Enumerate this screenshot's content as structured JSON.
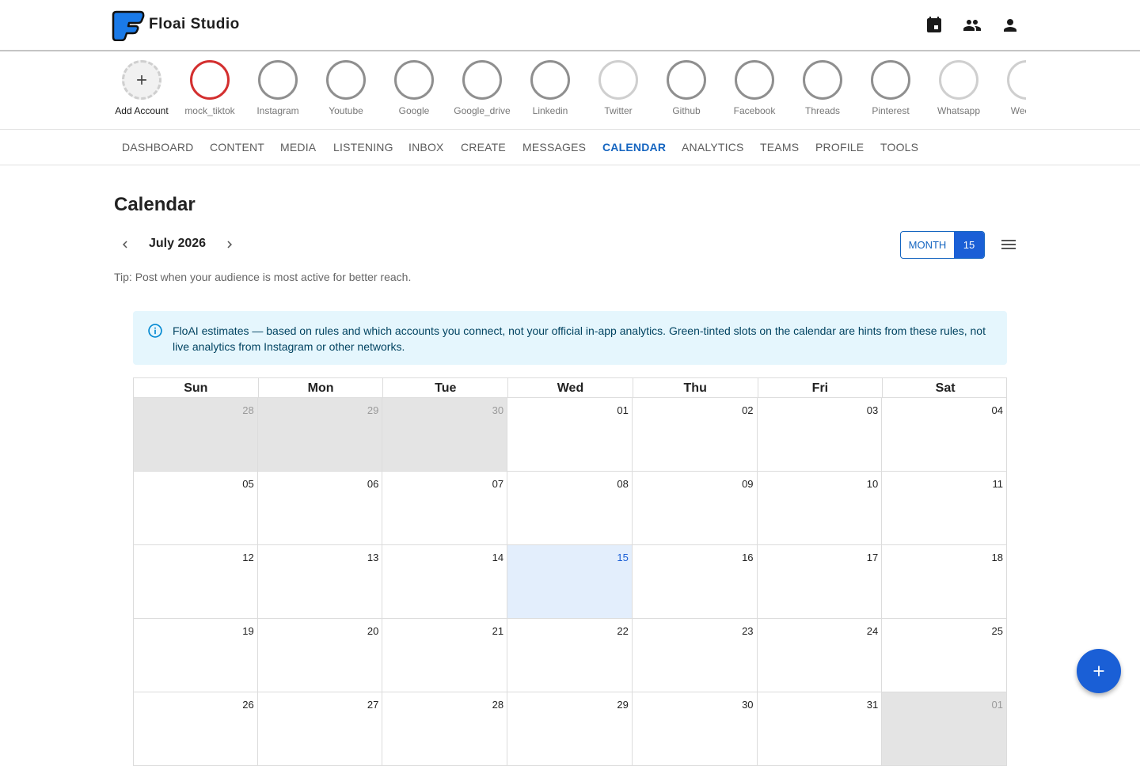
{
  "app": {
    "title": "Floai Studio"
  },
  "header_icons": [
    "calendar-icon",
    "people-icon",
    "person-icon"
  ],
  "accounts": [
    {
      "label": "Add Account",
      "kind": "add"
    },
    {
      "label": "mock_tiktok",
      "kind": "active"
    },
    {
      "label": "Instagram",
      "kind": "normal"
    },
    {
      "label": "Youtube",
      "kind": "normal"
    },
    {
      "label": "Google",
      "kind": "normal"
    },
    {
      "label": "Google_drive",
      "kind": "normal"
    },
    {
      "label": "Linkedin",
      "kind": "normal"
    },
    {
      "label": "Twitter",
      "kind": "light"
    },
    {
      "label": "Github",
      "kind": "normal"
    },
    {
      "label": "Facebook",
      "kind": "normal"
    },
    {
      "label": "Threads",
      "kind": "normal"
    },
    {
      "label": "Pinterest",
      "kind": "normal"
    },
    {
      "label": "Whatsapp",
      "kind": "light"
    },
    {
      "label": "Wechat",
      "kind": "light"
    }
  ],
  "nav": [
    {
      "label": "DASHBOARD"
    },
    {
      "label": "CONTENT"
    },
    {
      "label": "MEDIA"
    },
    {
      "label": "LISTENING"
    },
    {
      "label": "INBOX"
    },
    {
      "label": "CREATE"
    },
    {
      "label": "MESSAGES"
    },
    {
      "label": "CALENDAR",
      "active": true
    },
    {
      "label": "ANALYTICS"
    },
    {
      "label": "TEAMS"
    },
    {
      "label": "PROFILE"
    },
    {
      "label": "TOOLS"
    }
  ],
  "page": {
    "title": "Calendar",
    "month_label": "July 2026",
    "tip": "Tip: Post when your audience is most active for better reach.",
    "view_toggle": {
      "month": "MONTH",
      "day": "15"
    },
    "banner": "FloAI estimates — based on rules and which accounts you connect, not your official in-app analytics. Green-tinted slots on the calendar are hints from these rules, not live analytics from Instagram or other networks."
  },
  "calendar": {
    "weekdays": [
      "Sun",
      "Mon",
      "Tue",
      "Wed",
      "Thu",
      "Fri",
      "Sat"
    ],
    "weeks": [
      [
        {
          "d": "28",
          "o": true
        },
        {
          "d": "29",
          "o": true
        },
        {
          "d": "30",
          "o": true
        },
        {
          "d": "01"
        },
        {
          "d": "02"
        },
        {
          "d": "03"
        },
        {
          "d": "04"
        }
      ],
      [
        {
          "d": "05"
        },
        {
          "d": "06"
        },
        {
          "d": "07"
        },
        {
          "d": "08"
        },
        {
          "d": "09"
        },
        {
          "d": "10"
        },
        {
          "d": "11"
        }
      ],
      [
        {
          "d": "12"
        },
        {
          "d": "13"
        },
        {
          "d": "14"
        },
        {
          "d": "15",
          "t": true
        },
        {
          "d": "16"
        },
        {
          "d": "17"
        },
        {
          "d": "18"
        }
      ],
      [
        {
          "d": "19"
        },
        {
          "d": "20"
        },
        {
          "d": "21"
        },
        {
          "d": "22"
        },
        {
          "d": "23"
        },
        {
          "d": "24"
        },
        {
          "d": "25"
        }
      ],
      [
        {
          "d": "26"
        },
        {
          "d": "27"
        },
        {
          "d": "28"
        },
        {
          "d": "29"
        },
        {
          "d": "30"
        },
        {
          "d": "31"
        },
        {
          "d": "01",
          "o": true
        }
      ]
    ]
  },
  "colors": {
    "accent": "#1a5fd6",
    "active_ring": "#d32f2f",
    "today_bg": "#e3eefc",
    "banner_bg": "#e5f6fd"
  }
}
